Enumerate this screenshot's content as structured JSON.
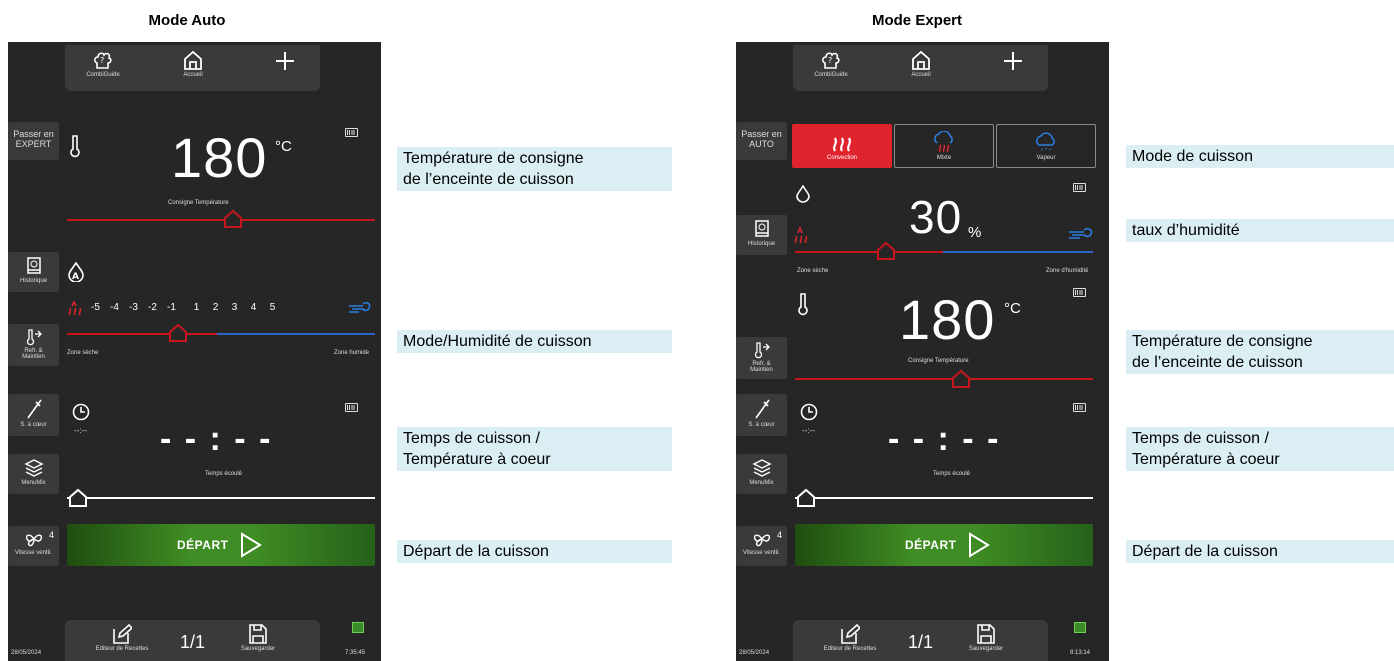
{
  "titles": {
    "left": "Mode Auto",
    "right": "Mode Expert"
  },
  "topbar": {
    "combiguide": "CombiGuide",
    "accueil": "Accueil"
  },
  "bottombar": {
    "editor": "Editeur de Recettes",
    "page": "1/1",
    "save": "Sauvegarder"
  },
  "left": {
    "switch_mode_line1": "Passer en",
    "switch_mode_line2": "EXPERT",
    "temp_value": "180",
    "temp_unit": "°C",
    "temp_label": "Consigne Température",
    "historique": "Historique",
    "humidity_scale": [
      "-5",
      "-4",
      "-3",
      "-2",
      "-1",
      "1",
      "2",
      "3",
      "4",
      "5"
    ],
    "zone_dry": "Zone sèche",
    "zone_humid": "Zone humide",
    "refr_line1": "Refr. &",
    "refr_line2": "Maintien",
    "probe": "S. à cœur",
    "time_small": "--:--",
    "time_big": "- - : - -",
    "time_label": "Temps écoulé",
    "menumix": "MenuMix",
    "fan_speed": "4",
    "fan_label": "Vitesse ventil.",
    "start": "DÉPART",
    "date": "28/05/2024",
    "clock": "7:35:45"
  },
  "right": {
    "switch_mode_line1": "Passer en",
    "switch_mode_line2": "AUTO",
    "modes": [
      "Convection",
      "Mixte",
      "Vapeur"
    ],
    "humidity_value": "30",
    "humidity_unit": "%",
    "zone_dry": "Zone sèche",
    "zone_humid": "Zone d'humidité",
    "historique": "Historique",
    "temp_value": "180",
    "temp_unit": "°C",
    "temp_label": "Consigne Température",
    "refr_line1": "Refr. &",
    "refr_line2": "Maintien",
    "probe": "S. à cœur",
    "time_small": "--:--",
    "time_big": "- - : - -",
    "time_label": "Temps écoulé",
    "menumix": "MenuMix",
    "fan_speed": "4",
    "fan_label": "Vitesse ventil.",
    "start": "DÉPART",
    "date": "28/05/2024",
    "clock": "8:13:14"
  },
  "callouts": {
    "left_temp": "Température de consigne\nde l’enceinte de cuisson",
    "left_mode": "Mode/Humidité de cuisson",
    "left_time": "Temps de cuisson /\nTempérature à coeur",
    "left_start": "Départ de la cuisson",
    "right_mode": "Mode de cuisson",
    "right_humidity": "taux d’humidité",
    "right_temp": "Température de consigne\nde l’enceinte de cuisson",
    "right_time": "Temps de cuisson /\nTempérature à coeur",
    "right_start": "Départ de la cuisson"
  },
  "colors": {
    "red": "#c4161c",
    "blue": "#2a64c6",
    "green": "#3f8d24",
    "callout_bg": "#daeef3",
    "screen_bg": "#262626"
  }
}
